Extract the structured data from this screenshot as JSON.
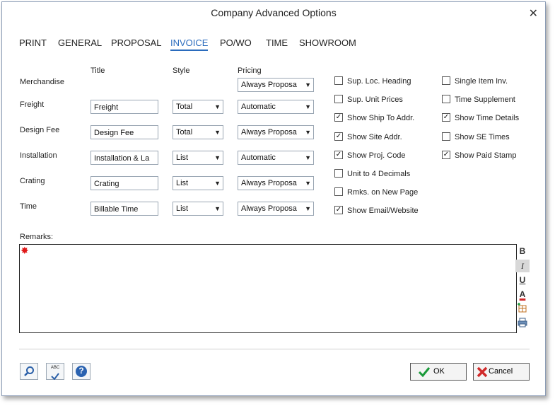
{
  "window": {
    "title": "Company Advanced Options",
    "close_symbol": "✕"
  },
  "tabs": [
    {
      "label": "PRINT"
    },
    {
      "label": "GENERAL"
    },
    {
      "label": "PROPOSAL"
    },
    {
      "label": "INVOICE",
      "active": true
    },
    {
      "label": "PO/WO"
    },
    {
      "label": "TIME"
    },
    {
      "label": "SHOWROOM"
    }
  ],
  "headers": {
    "title": "Title",
    "style": "Style",
    "pricing": "Pricing"
  },
  "rows": [
    {
      "label": "Merchandise",
      "title": "",
      "style": "",
      "pricing": "Always Proposa"
    },
    {
      "label": "Freight",
      "title": "Freight",
      "style": "Total",
      "pricing": "Automatic"
    },
    {
      "label": "Design Fee",
      "title": "Design Fee",
      "style": "Total",
      "pricing": "Always Proposa"
    },
    {
      "label": "Installation",
      "title": "Installation & La",
      "style": "List",
      "pricing": "Automatic"
    },
    {
      "label": "Crating",
      "title": "Crating",
      "style": "List",
      "pricing": "Always Proposa"
    },
    {
      "label": "Time",
      "title": "Billable Time",
      "style": "List",
      "pricing": "Always Proposa"
    }
  ],
  "options_left": [
    {
      "label": "Sup. Loc. Heading",
      "checked": false
    },
    {
      "label": "Sup. Unit Prices",
      "checked": false
    },
    {
      "label": "Show Ship To Addr.",
      "checked": true
    },
    {
      "label": "Show Site Addr.",
      "checked": true
    },
    {
      "label": "Show Proj. Code",
      "checked": true
    },
    {
      "label": "Unit to 4 Decimals",
      "checked": false
    },
    {
      "label": "Rmks. on New Page",
      "checked": false
    },
    {
      "label": "Show Email/Website",
      "checked": true
    }
  ],
  "options_right": [
    {
      "label": "Single Item Inv.",
      "checked": false
    },
    {
      "label": "Time Supplement",
      "checked": false
    },
    {
      "label": "Show Time Details",
      "checked": true
    },
    {
      "label": "Show SE Times",
      "checked": false
    },
    {
      "label": "Show Paid Stamp",
      "checked": true
    }
  ],
  "remarks": {
    "label": "Remarks:",
    "value": ""
  },
  "format_toolbar": {
    "bold": "B",
    "italic": "I",
    "underline": "U",
    "color": "A"
  },
  "bottom": {
    "search_icon": "search-icon",
    "spellcheck_label": "ABC",
    "help_label": "?",
    "ok_label": "OK",
    "cancel_label": "Cancel"
  },
  "colors": {
    "accent": "#2a6bbd",
    "ok_check": "#1a9a3a",
    "cancel_x": "#d02a2a",
    "cursor": "#e01818"
  }
}
